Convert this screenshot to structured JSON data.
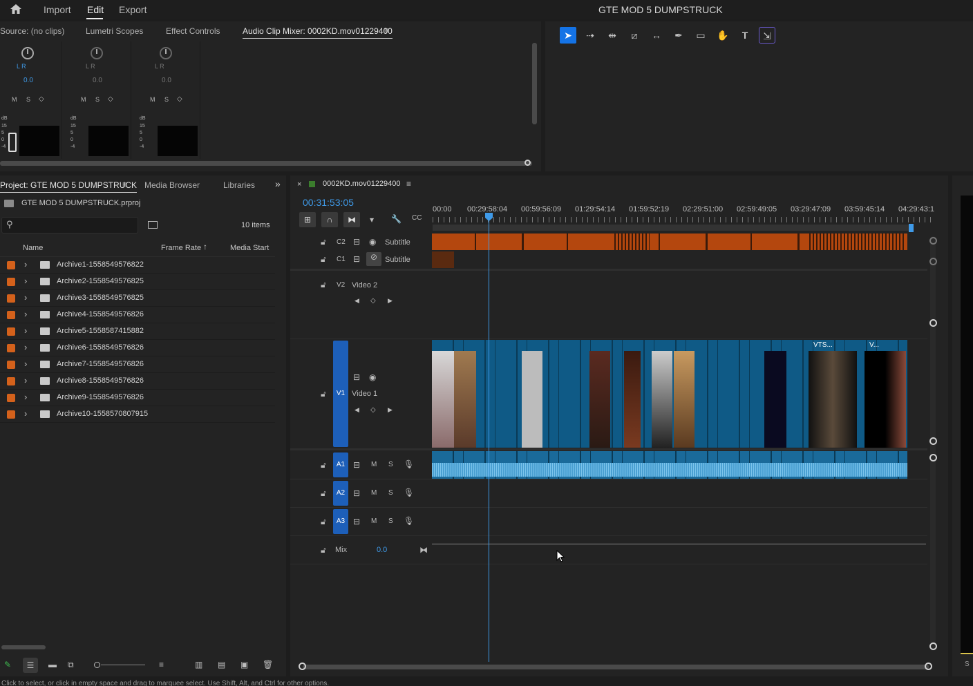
{
  "topbar": {
    "home": "home-icon",
    "menu": [
      "Import",
      "Edit",
      "Export"
    ],
    "active": "Edit",
    "title": "GTE MOD 5 DUMPSTRUCK"
  },
  "source_panel": {
    "tabs": [
      "Source: (no clips)",
      "Lumetri Scopes",
      "Effect Controls",
      "Audio Clip Mixer: 0002KD.mov01229400"
    ],
    "active_tab": "Audio Clip Mixer: 0002KD.mov01229400",
    "channels": [
      {
        "lr": "L R",
        "value": "0.0",
        "m": "M",
        "s": "S",
        "db": "dB",
        "scale": [
          "15",
          "5",
          "0",
          "-4"
        ]
      },
      {
        "lr": "L R",
        "value": "0.0",
        "m": "M",
        "s": "S",
        "db": "dB",
        "scale": [
          "15",
          "5",
          "0",
          "-4"
        ]
      },
      {
        "lr": "L R",
        "value": "0.0",
        "m": "M",
        "s": "S",
        "db": "dB",
        "scale": [
          "15",
          "5",
          "0",
          "-4"
        ]
      }
    ]
  },
  "tools": [
    "selection-tool",
    "track-select-tool",
    "ripple-edit-tool",
    "razor-tool",
    "slip-tool",
    "pen-tool",
    "rectangle-tool",
    "hand-tool",
    "type-tool",
    "generative-extend-tool"
  ],
  "project": {
    "tabs": [
      "Project: GTE MOD 5 DUMPSTRUCK",
      "Media Browser",
      "Libraries"
    ],
    "file": "GTE MOD 5 DUMPSTRUCK.prproj",
    "count": "10 items",
    "columns": {
      "name": "Name",
      "frame_rate": "Frame Rate",
      "media_start": "Media Start"
    },
    "items": [
      "Archive1-1558549576822",
      "Archive2-1558549576825",
      "Archive3-1558549576825",
      "Archive4-1558549576826",
      "Archive5-1558587415882",
      "Archive6-1558549576826",
      "Archive7-1558549576826",
      "Archive8-1558549576826",
      "Archive9-1558549576826",
      "Archive10-1558570807915"
    ]
  },
  "timeline": {
    "close": "×",
    "sequence": "0002KD.mov01229400",
    "timecode": "00:31:53:05",
    "ruler": [
      "00:00",
      "00:29:58:04",
      "00:59:56:09",
      "01:29:54:14",
      "01:59:52:19",
      "02:29:51:00",
      "02:59:49:05",
      "03:29:47:09",
      "03:59:45:14",
      "04:29:43:1"
    ],
    "tracks": {
      "c2": {
        "id": "C2",
        "name": "Subtitle"
      },
      "c1": {
        "id": "C1",
        "name": "Subtitle"
      },
      "v2": {
        "id": "V2",
        "name": "Video 2"
      },
      "v1": {
        "id": "V1",
        "name": "Video 1"
      },
      "a1": {
        "id": "A1",
        "m": "M",
        "s": "S"
      },
      "a2": {
        "id": "A2",
        "m": "M",
        "s": "S"
      },
      "a3": {
        "id": "A3",
        "m": "M",
        "s": "S"
      },
      "mix": {
        "name": "Mix",
        "value": "0.0"
      }
    },
    "clip_labels": [
      "VTS...",
      "V..."
    ]
  },
  "status": "Click to select, or click in empty space and drag to marquee select. Use Shift, Alt, and Ctrl for other options.",
  "program_hint": "S"
}
